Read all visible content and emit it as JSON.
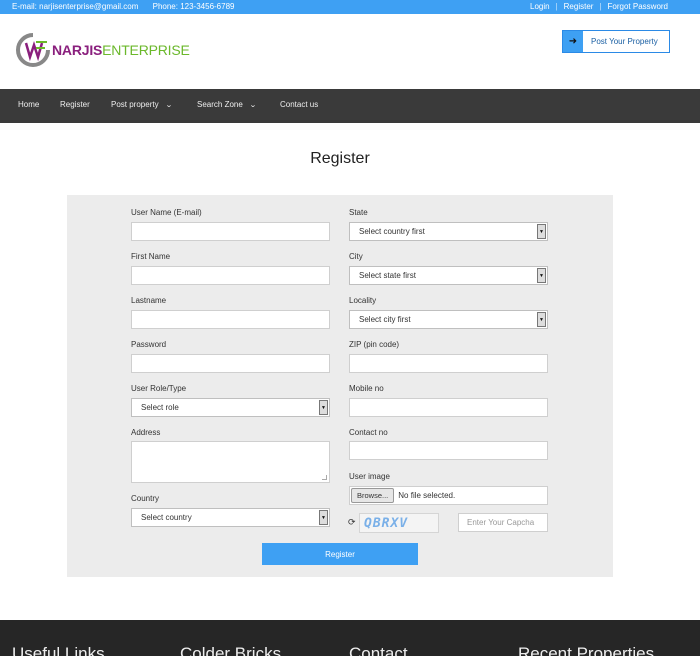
{
  "topbar": {
    "email": "E-mail: narjisenterprise@gmail.com",
    "phone": "Phone: 123-3456-6789",
    "links": [
      "Login",
      "Register",
      "Forgot Password"
    ],
    "bg_color": "#3ea0f3"
  },
  "header": {
    "logo_part1": "NARJIS",
    "logo_part2": "ENTERPRISE",
    "post_button": "Post Your Property",
    "post_icon": "arrow-right-icon"
  },
  "nav": {
    "items": [
      {
        "label": "Home",
        "dropdown": false
      },
      {
        "label": "Register",
        "dropdown": false
      },
      {
        "label": "Post property",
        "dropdown": true
      },
      {
        "label": "Search Zone",
        "dropdown": true
      },
      {
        "label": "Contact us",
        "dropdown": false
      }
    ],
    "bg_color": "#3a3a3a"
  },
  "page": {
    "title": "Register"
  },
  "form": {
    "username_label": "User Name (E-mail)",
    "firstname_label": "First Name",
    "lastname_label": "Lastname",
    "password_label": "Password",
    "role_label": "User Role/Type",
    "role_value": "Select role",
    "address_label": "Address",
    "country_label": "Country",
    "country_value": "Select country",
    "state_label": "State",
    "state_value": "Select country first",
    "city_label": "City",
    "city_value": "Select state first",
    "locality_label": "Locality",
    "locality_value": "Select city first",
    "zip_label": "ZIP (pin code)",
    "mobile_label": "Mobile no",
    "contact_label": "Contact no",
    "image_label": "User image",
    "browse_label": "Browse...",
    "file_status": "No file selected.",
    "captcha_text": "QBRXV",
    "captcha_placeholder": "Enter Your Capcha",
    "submit_label": "Register",
    "accent_color": "#3ea0f3"
  },
  "footer": {
    "headings": [
      "Useful Links",
      "Colder Bricks",
      "Contact",
      "Recent Properties"
    ]
  }
}
